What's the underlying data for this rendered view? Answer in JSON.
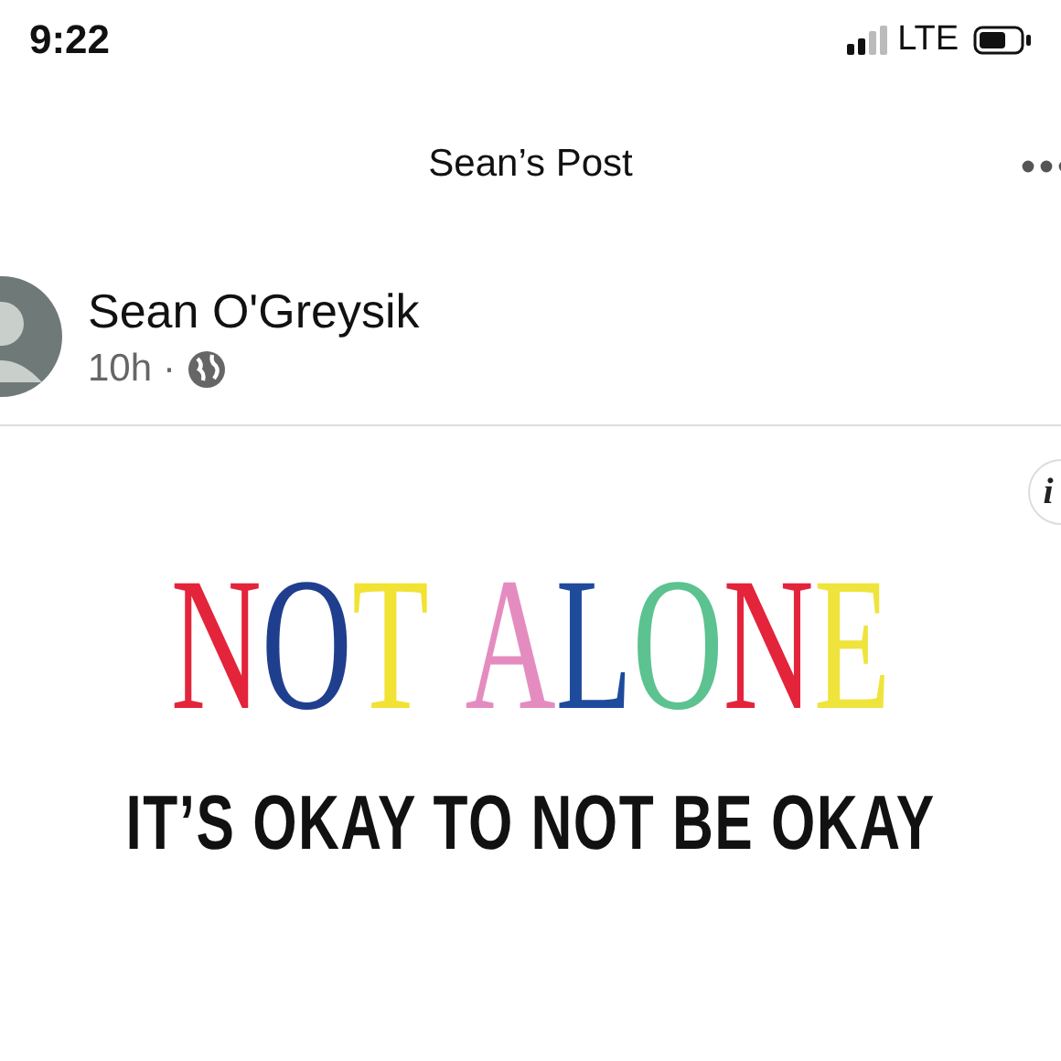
{
  "status_bar": {
    "time": "9:22",
    "network": "LTE"
  },
  "header": {
    "title": "Sean’s Post"
  },
  "post": {
    "author": "Sean O'Greysik",
    "time": "10h",
    "separator": "·",
    "image": {
      "info": "i",
      "headline_words": [
        [
          {
            "char": "N",
            "color": "#e3243b"
          },
          {
            "char": "O",
            "color": "#1f3f8e"
          },
          {
            "char": "T",
            "color": "#f1e234"
          }
        ],
        [
          {
            "char": "A",
            "color": "#e48cc0"
          },
          {
            "char": "L",
            "color": "#1e4b9b"
          },
          {
            "char": "O",
            "color": "#5cc290"
          },
          {
            "char": "N",
            "color": "#e3243b"
          },
          {
            "char": "E",
            "color": "#efe43c"
          }
        ]
      ],
      "tagline": "IT’S OKAY TO NOT BE OKAY"
    }
  }
}
